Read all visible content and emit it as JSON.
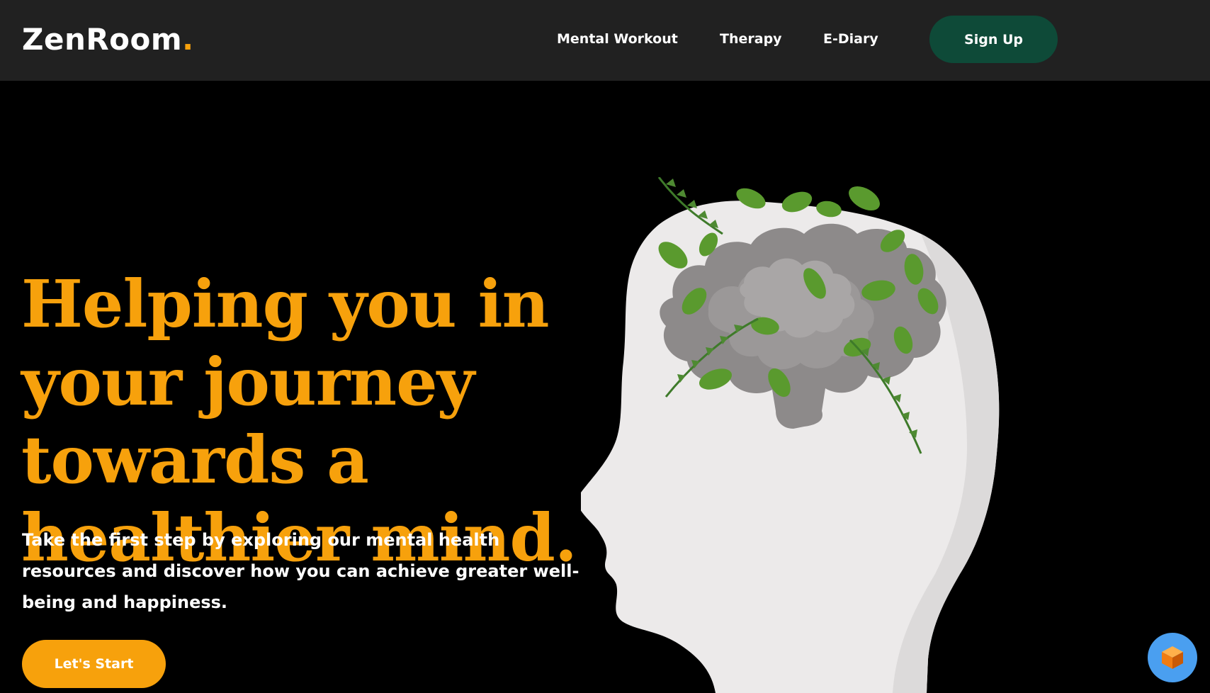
{
  "brand": {
    "name": "ZenRoom",
    "dot": ".",
    "accent": "#f7a10c"
  },
  "nav": {
    "links": [
      "Mental Workout",
      "Therapy",
      "E-Diary"
    ],
    "signup_label": "Sign Up",
    "signup_color": "#0e4a38",
    "background": "#212121"
  },
  "hero": {
    "headline": "Helping you in your journey towards a healthier mind.",
    "subtext": "Take the first step by exploring our mental health resources and discover how you can achieve greater well-being and happiness.",
    "cta_label": "Let's Start",
    "image": "head-silhouette-with-brain-and-leaves"
  },
  "widget": {
    "icon": "box-icon",
    "color": "#4a9ff0"
  }
}
